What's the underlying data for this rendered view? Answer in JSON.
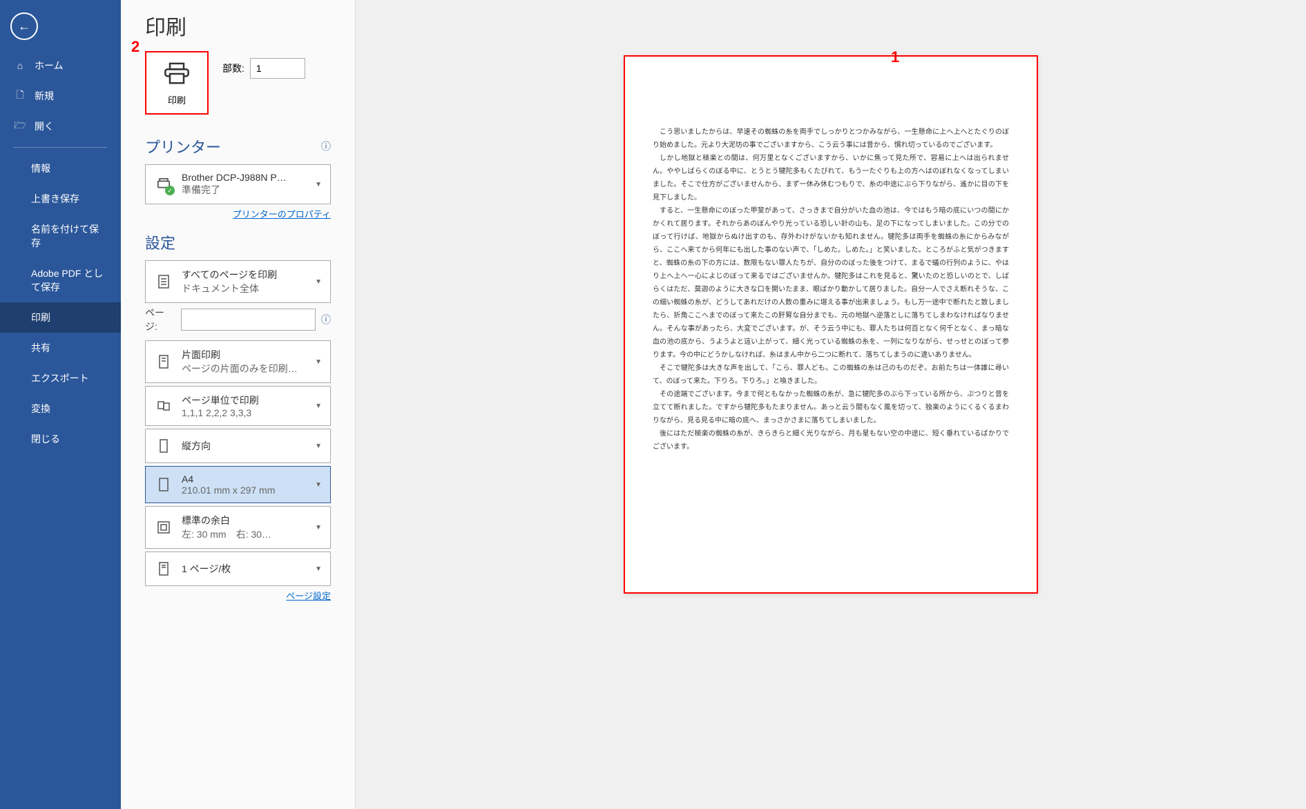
{
  "page_title": "印刷",
  "markers": {
    "one": "1",
    "two": "2"
  },
  "sidebar": {
    "home": "ホーム",
    "new": "新規",
    "open": "開く",
    "info": "情報",
    "save_overwrite": "上書き保存",
    "save_as": "名前を付けて保存",
    "save_pdf": "Adobe PDF として保存",
    "print": "印刷",
    "share": "共有",
    "export": "エクスポート",
    "convert": "変換",
    "close": "閉じる"
  },
  "print_button_label": "印刷",
  "copies": {
    "label": "部数:",
    "value": "1"
  },
  "printer_section": {
    "title": "プリンター",
    "name": "Brother DCP-J988N P…",
    "status": "準備完了",
    "properties_link": "プリンターのプロパティ"
  },
  "settings_section": {
    "title": "設定",
    "all_pages": {
      "title": "すべてのページを印刷",
      "sub": "ドキュメント全体"
    },
    "pages_label": "ページ:",
    "one_sided": {
      "title": "片面印刷",
      "sub": "ページの片面のみを印刷し…"
    },
    "collate": {
      "title": "ページ単位で印刷",
      "sub": "1,1,1    2,2,2    3,3,3"
    },
    "orientation": {
      "title": "縦方向"
    },
    "paper": {
      "title": "A4",
      "sub": "210.01 mm x 297 mm"
    },
    "margins": {
      "title": "標準の余白",
      "sub": "左: 30 mm　右: 30…"
    },
    "pages_per_sheet": {
      "title": "1 ページ/枚"
    },
    "page_setup_link": "ページ設定"
  },
  "preview": {
    "paragraphs": [
      "こう思いましたからは、早速その蜘蛛の糸を両手でしっかりとつかみながら、一生懸命に上へ上へとたぐりのぼり始めました。元より大泥坊の事でございますから、こう云う事には昔から、慣れ切っているのでございます。",
      "しかし地獄と極楽との間は、何万里となくございますから、いかに焦って見た所で、容易に上へは出られません。ややしばらくのぼる中に、とうとう犍陀多もくたびれて、もう一たぐりも上の方へはのぼれなくなってしまいました。そこで仕方がございませんから、まず一休み休むつもりで、糸の中途にぶら下りながら、遙かに目の下を見下しました。",
      "すると、一生懸命にのぼった甲斐があって、さっきまで自分がいた血の池は、今ではもう暗の底にいつの間にかかくれて居ります。それからあのぼんやり光っている恐しい針の山も、足の下になってしまいました。この分でのぼって行けば、地獄からぬけ出すのも、存外わけがないかも知れません。犍陀多は両手を蜘蛛の糸にからみながら、ここへ来てから何年にも出した事のない声で、「しめた。しめた。」と笑いました。ところがふと気がつきますと、蜘蛛の糸の下の方には、数限もない罪人たちが、自分ののぼった後をつけて、まるで蟻の行列のように、やはり上へ上へ一心によじのぼって来るではございませんか。犍陀多はこれを見ると、驚いたのと恐しいのとで、しばらくはただ、莫迦のように大きな口を開いたまま、眼ばかり動かして居りました。自分一人でさえ断れそうな、この細い蜘蛛の糸が、どうしてあれだけの人数の重みに堪える事が出来ましょう。もし万一途中で断れたと致しましたら、折角ここへまでのぼって来たこの肝腎な自分までも、元の地獄へ逆落としに落ちてしまわなければなりません。そんな事があったら、大変でございます。が、そう云う中にも、罪人たちは何百となく何千となく、まっ暗な血の池の底から、うようよと這い上がって、細く光っている蜘蛛の糸を、一列になりながら、せっせとのぼって参ります。今の中にどうかしなければ、糸はまん中から二つに断れて、落ちてしまうのに違いありません。",
      "そこで犍陀多は大きな声を出して、「こら、罪人ども。この蜘蛛の糸は己のものだぞ。お前たちは一体誰に尋いて、のぼって来た。下りろ。下りろ。」と喚きました。",
      "その途端でございます。今まで何ともなかった蜘蛛の糸が、急に犍陀多のぶら下っている所から、ぷつりと音を立てて断れました。ですから犍陀多もたまりません。あっと云う間もなく風を切って、独楽のようにくるくるまわりながら、見る見る中に暗の底へ、まっさかさまに落ちてしまいました。",
      "後にはただ極楽の蜘蛛の糸が、きらきらと細く光りながら、月も星もない空の中途に、短く垂れているばかりでございます。"
    ]
  }
}
